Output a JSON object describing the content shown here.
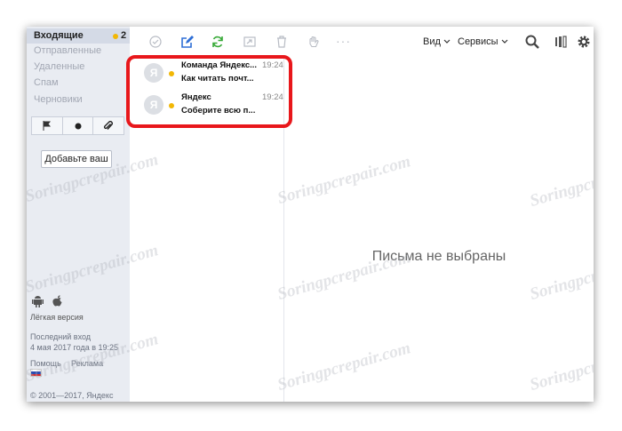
{
  "sidebar": {
    "folders": [
      {
        "label": "Входящие",
        "count": "2"
      },
      {
        "label": "Отправленные"
      },
      {
        "label": "Удаленные"
      },
      {
        "label": "Спам"
      },
      {
        "label": "Черновики"
      }
    ],
    "add_button": "Добавьте ваш",
    "light_version": "Лёгкая версия",
    "last_login_label": "Последний вход",
    "last_login_value": "4 мая 2017 года в 19:25",
    "help": "Помощь",
    "ads": "Реклама",
    "copyright": "© 2001—2017, Яндекс"
  },
  "toolbar": {
    "view": "Вид",
    "services": "Сервисы",
    "dots": "···"
  },
  "messages": [
    {
      "avatar": "Я",
      "from": "Команда Яндекс...",
      "subject": "Как читать почт...",
      "time": "19:24"
    },
    {
      "avatar": "Я",
      "from": "Яндекс",
      "subject": "Соберите всю п...",
      "time": "19:24"
    }
  ],
  "main": {
    "empty_text": "Письма не выбраны"
  },
  "watermark": "Soringpcrepair.com",
  "colors": {
    "accent_blue": "#2f6fd6",
    "refresh_green": "#37a937",
    "unread_dot": "#f2b705",
    "highlight_red": "#e8171b"
  }
}
